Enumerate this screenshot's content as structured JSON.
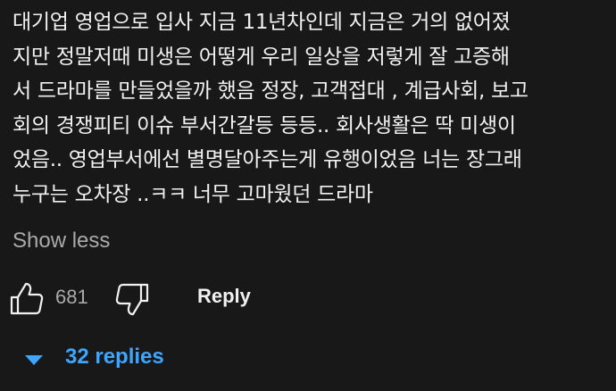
{
  "comment": {
    "lines": [
      "대기업 영업으로 입사 지금 11년차인데 지금은 거의 없어졌",
      "지만 정말저때 미생은 어떻게 우리 일상을 저렇게 잘 고증해",
      "서 드라마를 만들었을까 했음 정장, 고객접대 , 계급사회, 보고",
      "회의 경쟁피티 이슈 부서간갈등 등등.. 회사생활은 딱 미생이",
      "었음.. 영업부서에선 별명달아주는게 유행이었음 너는 장그래",
      "누구는 오차장 ..ㅋㅋ 너무 고마웠던 드라마"
    ],
    "show_less_label": "Show less"
  },
  "actions": {
    "like_icon": "thumbs-up-outline",
    "like_count": "681",
    "dislike_icon": "thumbs-down-outline",
    "reply_label": "Reply"
  },
  "replies": {
    "icon": "caret-down",
    "label": "32 replies",
    "color": "#3ea6ff"
  },
  "colors": {
    "background": "#181818",
    "text_primary": "#f1f1f1",
    "text_secondary": "#aaaaaa",
    "accent": "#3ea6ff"
  }
}
